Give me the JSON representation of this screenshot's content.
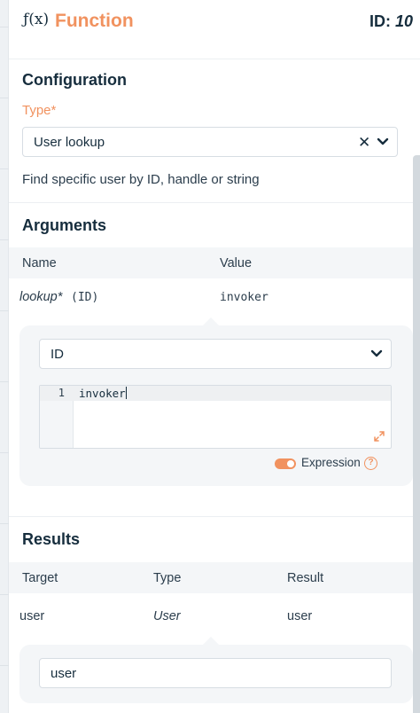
{
  "header": {
    "icon": "function-icon",
    "fx_glyph": "ƒ(x)",
    "title": "Function",
    "id_label": "ID:",
    "id_value": "10"
  },
  "configuration": {
    "title": "Configuration",
    "type_label": "Type*",
    "type_value": "User lookup",
    "description": "Find specific user by ID, handle or string"
  },
  "arguments": {
    "title": "Arguments",
    "columns": [
      "Name",
      "Value"
    ],
    "rows": [
      {
        "name": "lookup*",
        "type_hint": "(ID)",
        "value": "invoker"
      }
    ],
    "editor": {
      "select_value": "ID",
      "line_number": "1",
      "code": "invoker",
      "toggle_label": "Expression",
      "toggle_on": true,
      "help_glyph": "?"
    }
  },
  "results": {
    "title": "Results",
    "columns": [
      "Target",
      "Type",
      "Result"
    ],
    "rows": [
      {
        "target": "user",
        "type": "User",
        "result": "user"
      }
    ],
    "target_input_value": "user"
  },
  "colors": {
    "accent": "#f1925f",
    "text": "#162d3d",
    "panel_bg": "#f4f6f8"
  }
}
